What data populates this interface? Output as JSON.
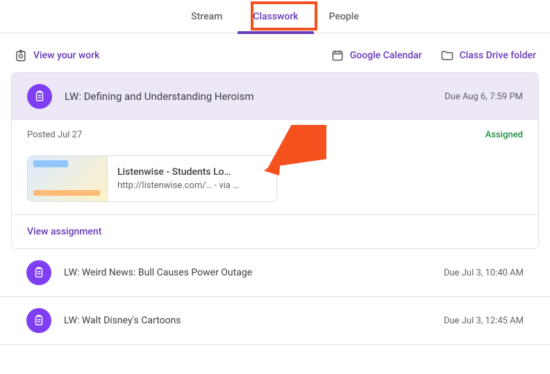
{
  "tabs": {
    "stream": "Stream",
    "classwork": "Classwork",
    "people": "People"
  },
  "actionbar": {
    "view_work": "View your work",
    "calendar": "Google Calendar",
    "drive": "Class Drive folder"
  },
  "expanded": {
    "title": "LW: Defining and Understanding Heroism",
    "due": "Due Aug 6, 7:59 PM",
    "posted": "Posted Jul 27",
    "status": "Assigned",
    "attachment": {
      "title": "Listenwise - Students Lo…",
      "subtitle": "http://listenwise.com/…  - via …"
    },
    "view": "View assignment"
  },
  "rows": [
    {
      "title": "LW: Weird News: Bull Causes Power Outage",
      "due": "Due Jul 3, 10:40 AM"
    },
    {
      "title": "LW: Walt Disney's Cartoons",
      "due": "Due Jul 3, 12:45 AM"
    }
  ]
}
